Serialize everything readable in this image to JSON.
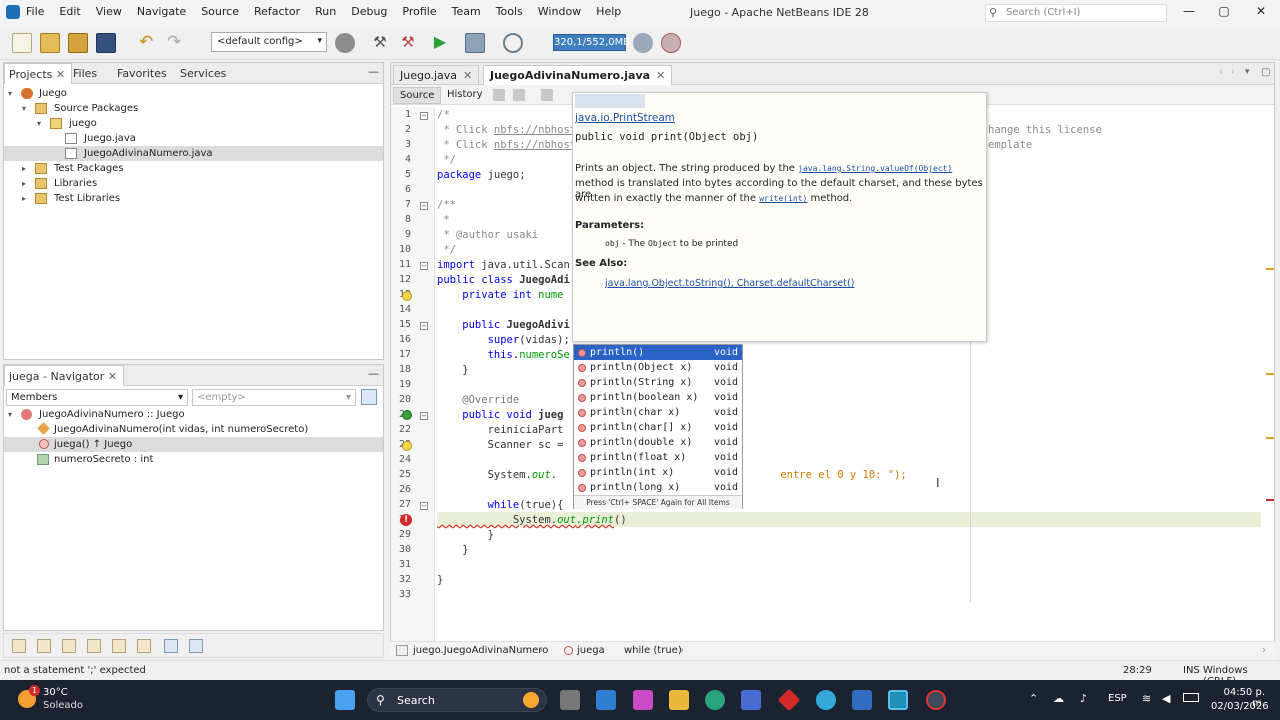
{
  "window": {
    "title": "Juego - Apache NetBeans IDE 28",
    "menu": [
      "File",
      "Edit",
      "View",
      "Navigate",
      "Source",
      "Refactor",
      "Run",
      "Debug",
      "Profile",
      "Team",
      "Tools",
      "Window",
      "Help"
    ],
    "search_placeholder": "Search (Ctrl+I)"
  },
  "toolbar": {
    "config": "<default config>",
    "memory": "320,1/552,0MB"
  },
  "projects_panel": {
    "tabs": [
      "Projects",
      "Files",
      "Favorites",
      "Services"
    ],
    "tree": [
      {
        "label": "Juego",
        "depth": 0
      },
      {
        "label": "Source Packages",
        "depth": 1
      },
      {
        "label": "juego",
        "depth": 2
      },
      {
        "label": "Juego.java",
        "depth": 3
      },
      {
        "label": "JuegoAdivinaNumero.java",
        "depth": 3,
        "selected": true
      },
      {
        "label": "Test Packages",
        "depth": 1
      },
      {
        "label": "Libraries",
        "depth": 1
      },
      {
        "label": "Test Libraries",
        "depth": 1
      }
    ]
  },
  "navigator": {
    "title": "juega - Navigator",
    "filter": "Members",
    "empty_combo": "<empty>",
    "items": [
      {
        "label": "JuegoAdivinaNumero :: Juego"
      },
      {
        "label": "JuegoAdivinaNumero(int vidas, int numeroSecreto)"
      },
      {
        "label": "juega() ↑ Juego",
        "selected": true
      },
      {
        "label": "numeroSecreto : int"
      }
    ]
  },
  "editor": {
    "tabs": [
      "Juego.java",
      "JuegoAdivinaNumero.java"
    ],
    "source_tab": "Source",
    "history_tab": "History",
    "line_numbers": [
      "1",
      "2",
      "3",
      "4",
      "5",
      "6",
      "7",
      "8",
      "9",
      "10",
      "11",
      "12",
      "13",
      "14",
      "15",
      "16",
      "17",
      "18",
      "19",
      "20",
      "21",
      "22",
      "23",
      "24",
      "25",
      "26",
      "27",
      "28",
      "29",
      "30",
      "31",
      "32",
      "33"
    ],
    "lines": {
      "l1": "/*",
      "l2a": " * Click ",
      "l2b": "nbfs://nbhost",
      "l3a": " * Click ",
      "l3b": "nbfs://nbhost",
      "l4": " */",
      "l5a": "package",
      "l5b": " juego;",
      "l7": "/**",
      "l8": " *",
      "l9": " * @author usaki",
      "l10": " */",
      "l11a": "import",
      "l11b": " java.util.Scan",
      "l12a": "public class ",
      "l12b": "JuegoAdi",
      "l13a": "    private int ",
      "l13b": "nume",
      "l15a": "    public ",
      "l15b": "JuegoAdivi",
      "l16a": "        super",
      "l16b": "(vidas);",
      "l17a": "        this.",
      "l17b": "numeroSe",
      "l18": "    }",
      "l20": "    @Override",
      "l21a": "    public void ",
      "l21b": "jueg",
      "l22": "        reiniciaPart",
      "l23a": "        Scanner ",
      "l23b": "sc = ",
      "l25a": "        System.",
      "l25b": "out",
      "l25c": ".",
      "l25d": " entre el 0 y 10: \");",
      "l27a": "        while",
      "l27b": "(true){",
      "l28a": "            System.",
      "l28b": "out",
      "l28c": ".print",
      "l28d": "()",
      "l29": "        }",
      "l30": "    }",
      "l32": "}",
      "right1": "hange this license",
      "right2": "emplate"
    }
  },
  "javadoc": {
    "class_link": "java.io.PrintStream",
    "signature": "public void print(Object obj)",
    "desc1a": "Prints an object. The string produced by the ",
    "desc1b": "java.lang.String.valueOf(Object)",
    "desc2": "method is translated into bytes according to the default charset, and these bytes are",
    "desc3a": "written in exactly the manner of the ",
    "desc3b": "write(int)",
    "desc3c": " method.",
    "params_title": "Parameters:",
    "param_name": "obj",
    "param_desc1": " - The ",
    "param_mono": "Object",
    "param_desc2": " to be printed",
    "see_title": "See Also:",
    "see_links": "java.lang.Object.toString(), Charset.defaultCharset()"
  },
  "completion": {
    "items": [
      {
        "name": "println()",
        "type": "void",
        "selected": true
      },
      {
        "name": "println(Object x)",
        "type": "void"
      },
      {
        "name": "println(String x)",
        "type": "void"
      },
      {
        "name": "println(boolean x)",
        "type": "void"
      },
      {
        "name": "println(char x)",
        "type": "void"
      },
      {
        "name": "println(char[] x)",
        "type": "void"
      },
      {
        "name": "println(double x)",
        "type": "void"
      },
      {
        "name": "println(float x)",
        "type": "void"
      },
      {
        "name": "println(int x)",
        "type": "void"
      },
      {
        "name": "println(long x)",
        "type": "void"
      }
    ],
    "hint": "Press 'Ctrl+ SPACE' Again for All Items"
  },
  "breadcrumbs": [
    "juego.JuegoAdivinaNumero",
    "juega",
    "while (true)"
  ],
  "status": {
    "message": "not a statement  ';' expected",
    "position": "28:29",
    "mode": "INS",
    "line_ending": "Windows (CRLF)"
  },
  "taskbar": {
    "temperature": "30°C",
    "weather": "Soleado",
    "notification_count": "1",
    "search": "Search",
    "language": "ESP",
    "time": "04:50 p. m.",
    "date": "02/03/2026"
  },
  "colors": {
    "accent": "#2a62c8",
    "memory": "#3f7fc0",
    "error": "#d22a2a",
    "current_line": "#e9efd8"
  }
}
